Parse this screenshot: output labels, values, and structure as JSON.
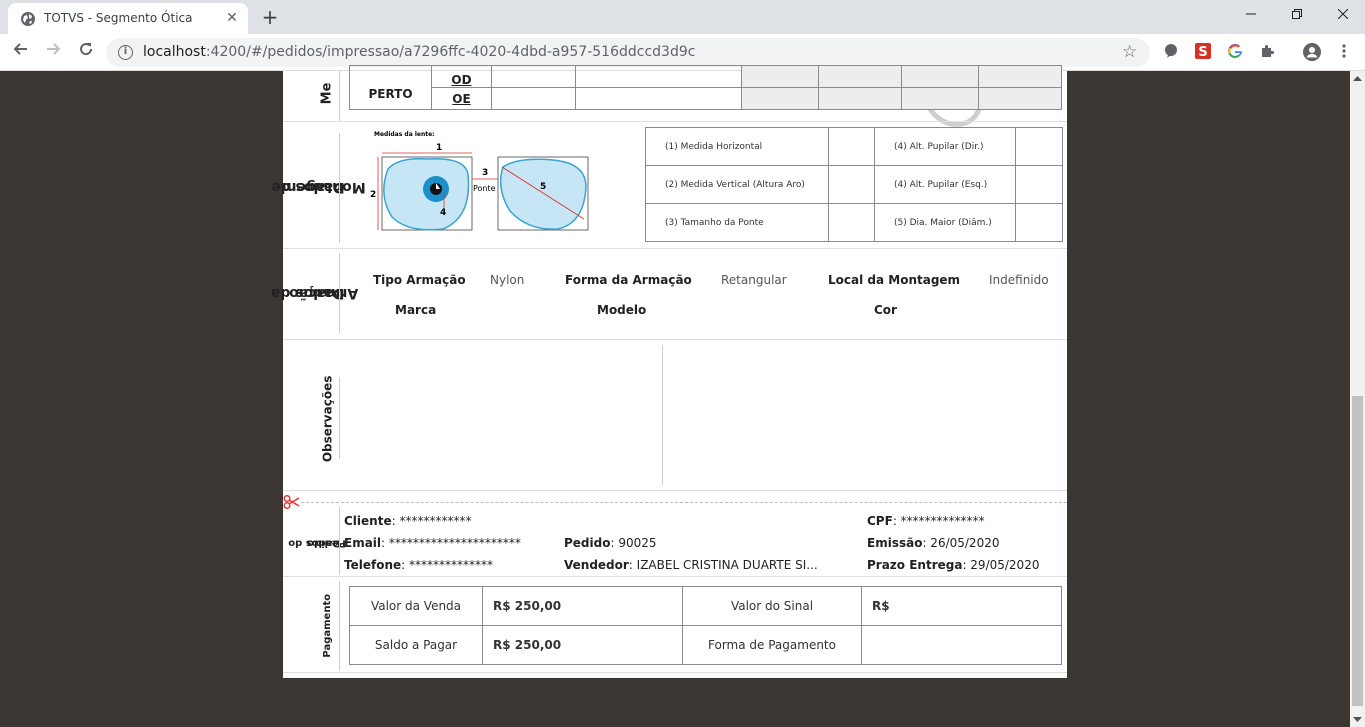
{
  "browser": {
    "tab_title": "TOTVS - Segmento Ótica",
    "url_host": "localhost",
    "url_path": ":4200/#/pedidos/impressao/a7296ffc-4020-4dbd-a957-516ddccd3d9c",
    "tab_close": "✕",
    "new_tab": "+"
  },
  "medidas": {
    "label": "Me",
    "perto": "PERTO",
    "od": "OD",
    "oe": "OE"
  },
  "montagem": {
    "label_line1": "Dados de",
    "label_line2": "Montagem",
    "image_caption": "Medidas da lente:",
    "image_labels": [
      "1",
      "2",
      "3",
      "4",
      "5",
      "Ponte"
    ],
    "rows": [
      [
        "(1) Medida Horizontal",
        "(4) Alt. Pupilar (Dir.)"
      ],
      [
        "(2) Medida Vertical (Altura Aro)",
        "(4) Alt. Pupilar (Esq.)"
      ],
      [
        "(3) Tamanho da Ponte",
        "(5) Dia. Maior (Diâm.)"
      ]
    ]
  },
  "armacao": {
    "label_line1": "Dados da",
    "label_line2": "Armação",
    "tipo_label": "Tipo Armação",
    "tipo_value": "Nylon",
    "forma_label": "Forma da Armação",
    "forma_value": "Retangular",
    "local_label": "Local da Montagem",
    "local_value": "Indefinido",
    "marca_label": "Marca",
    "modelo_label": "Modelo",
    "cor_label": "Cor"
  },
  "observacoes": {
    "label": "Observações"
  },
  "pedido": {
    "label_line1": "Dados do",
    "label_line2": "Pedido",
    "cliente_label": "Cliente",
    "cliente_value": ": ************",
    "cpf_label": "CPF",
    "cpf_value": ": **************",
    "email_label": "Email",
    "email_value": ": **********************",
    "pedido_label": "Pedido",
    "pedido_value": ": 90025",
    "emissao_label": "Emissão",
    "emissao_value": ": 26/05/2020",
    "telefone_label": "Telefone",
    "telefone_value": ": **************",
    "vendedor_label": "Vendedor",
    "vendedor_value": ": IZABEL CRISTINA DUARTE SI...",
    "prazo_label": "Prazo Entrega",
    "prazo_value": ": 29/05/2020"
  },
  "pagamento": {
    "label": "Pagamento",
    "valor_venda_label": "Valor da Venda",
    "valor_venda": "R$ 250,00",
    "valor_sinal_label": "Valor do Sinal",
    "valor_sinal": "R$",
    "saldo_label": "Saldo a Pagar",
    "saldo": "R$ 250,00",
    "forma_label": "Forma de Pagamento",
    "forma": ""
  },
  "colors": {
    "accent_scissors": "#e53935",
    "page_bg": "#3b3631"
  }
}
